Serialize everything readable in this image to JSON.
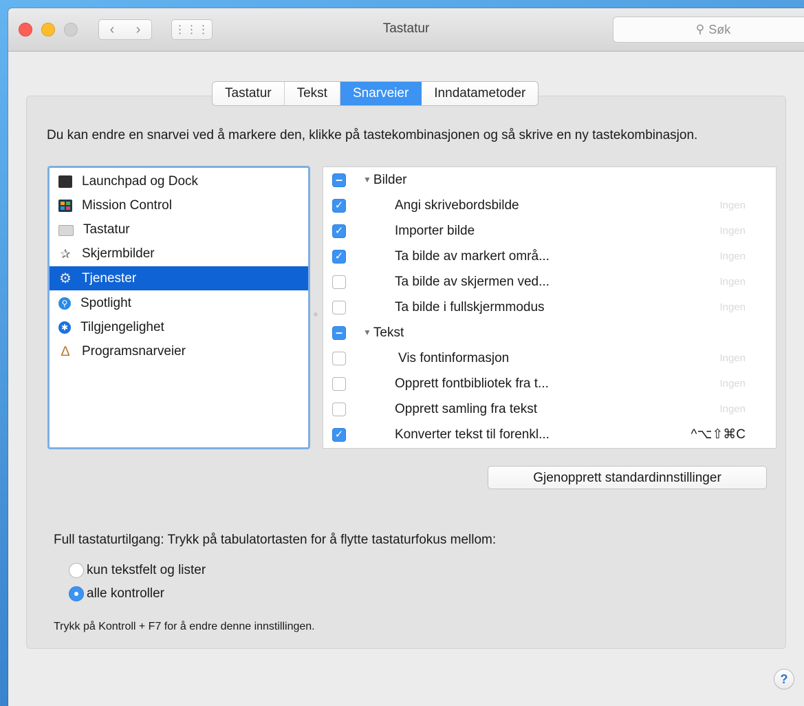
{
  "window": {
    "title": "Tastatur",
    "search_placeholder": "Søk",
    "nav_back_icon": "‹",
    "nav_forward_icon": "›",
    "grid_icon": "⋮⋮⋮"
  },
  "tabs": [
    {
      "label": "Tastatur",
      "active": false
    },
    {
      "label": "Tekst",
      "active": false
    },
    {
      "label": "Snarveier",
      "active": true
    },
    {
      "label": "Inndatametoder",
      "active": false
    }
  ],
  "intro": "Du kan endre en snarvei ved å markere den, klikke på tastekombinasjonen og så skrive en ny tastekombinasjon.",
  "categories": [
    {
      "label": "Launchpad og Dock",
      "icon": "launchpad-icon"
    },
    {
      "label": "Mission Control",
      "icon": "mission-control-icon"
    },
    {
      "label": "Tastatur",
      "icon": "keyboard-icon"
    },
    {
      "label": "Skjermbilder",
      "icon": "screenshot-icon"
    },
    {
      "label": "Tjenester",
      "icon": "services-gear-icon",
      "selected": true
    },
    {
      "label": "Spotlight",
      "icon": "spotlight-icon"
    },
    {
      "label": "Tilgjengelighet",
      "icon": "accessibility-icon"
    },
    {
      "label": "Programsnarveier",
      "icon": "app-shortcuts-icon"
    }
  ],
  "shortcuts": {
    "group_bilder": "Bilder",
    "group_tekst": "Tekst",
    "items": [
      {
        "label": "Angi skrivebordsbilde",
        "key": "Ingen",
        "checked": true
      },
      {
        "label": "Importer bilde",
        "key": "Ingen",
        "checked": true
      },
      {
        "label": "Ta bilde av markert områ...",
        "key": "Ingen",
        "checked": true
      },
      {
        "label": "Ta bilde av skjermen ved...",
        "key": "Ingen",
        "checked": false
      },
      {
        "label": "Ta bilde i fullskjermmodus",
        "key": "Ingen",
        "checked": false
      },
      {
        "label": "Vis fontinformasjon",
        "key": "Ingen",
        "checked": false
      },
      {
        "label": "Opprett fontbibliotek fra t...",
        "key": "Ingen",
        "checked": false
      },
      {
        "label": "Opprett samling fra tekst",
        "key": "Ingen",
        "checked": false
      },
      {
        "label": "Konverter tekst til forenkl...",
        "key": "^⌥⇧⌘C",
        "checked": true
      }
    ]
  },
  "restore_button": "Gjenopprett standardinnstillinger",
  "full_keyboard_access": {
    "label": "Full tastaturtilgang: Trykk på tabulatortasten for å flytte tastaturfokus mellom:",
    "option_1": "kun tekstfelt og lister",
    "option_2": "alle kontroller",
    "selected": "alle kontroller"
  },
  "hint": "Trykk på Kontroll + F7 for å endre denne innstillingen.",
  "help_label": "?"
}
